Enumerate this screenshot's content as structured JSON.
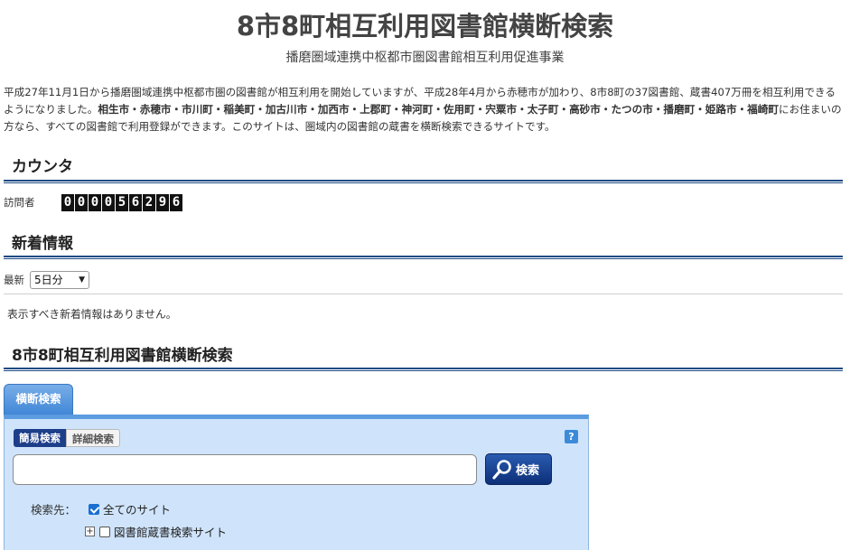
{
  "header": {
    "title": "8市8町相互利用図書館横断検索",
    "subtitle": "播磨圏域連携中枢都市圏図書館相互利用促進事業"
  },
  "intro": {
    "lead": "平成27年11月1日から播磨圏域連携中枢都市圏の図書館が相互利用を開始していますが、平成28年4月から赤穂市が加わり、8市8町の37図書館、蔵書407万冊を相互利用できるようになりました。",
    "municipalities": "相生市・赤穂市・市川町・稲美町・加古川市・加西市・上郡町・神河町・佐用町・宍粟市・太子町・高砂市・たつの市・播磨町・姫路市・福崎町",
    "tail": "にお住まいの方なら、すべての図書館で利用登録ができます。このサイトは、圏域内の図書館の蔵書を横断検索できるサイトです。"
  },
  "counter": {
    "heading": "カウンタ",
    "label": "訪問者",
    "digits": [
      "0",
      "0",
      "0",
      "0",
      "5",
      "6",
      "2",
      "9",
      "6"
    ]
  },
  "news": {
    "heading": "新着情報",
    "latest_label": "最新",
    "period_selected": "5日分",
    "empty_message": "表示すべき新着情報はありません。"
  },
  "search": {
    "heading": "8市8町相互利用図書館横断検索",
    "panel_tab": "横断検索",
    "mode_simple": "簡易検索",
    "mode_detail": "詳細検索",
    "help": "?",
    "query_value": "",
    "button_label": "検索",
    "target_label": "検索先：",
    "all_sites_label": "全てのサイト",
    "all_sites_checked": true,
    "library_sites_label": "図書館蔵書検索サイト",
    "library_sites_checked": false
  },
  "colors": {
    "section_rule": "#1d4b84",
    "panel_bg": "#cfe4fb",
    "tab_blue": "#3f86d6",
    "button_navy": "#0d2f78"
  }
}
